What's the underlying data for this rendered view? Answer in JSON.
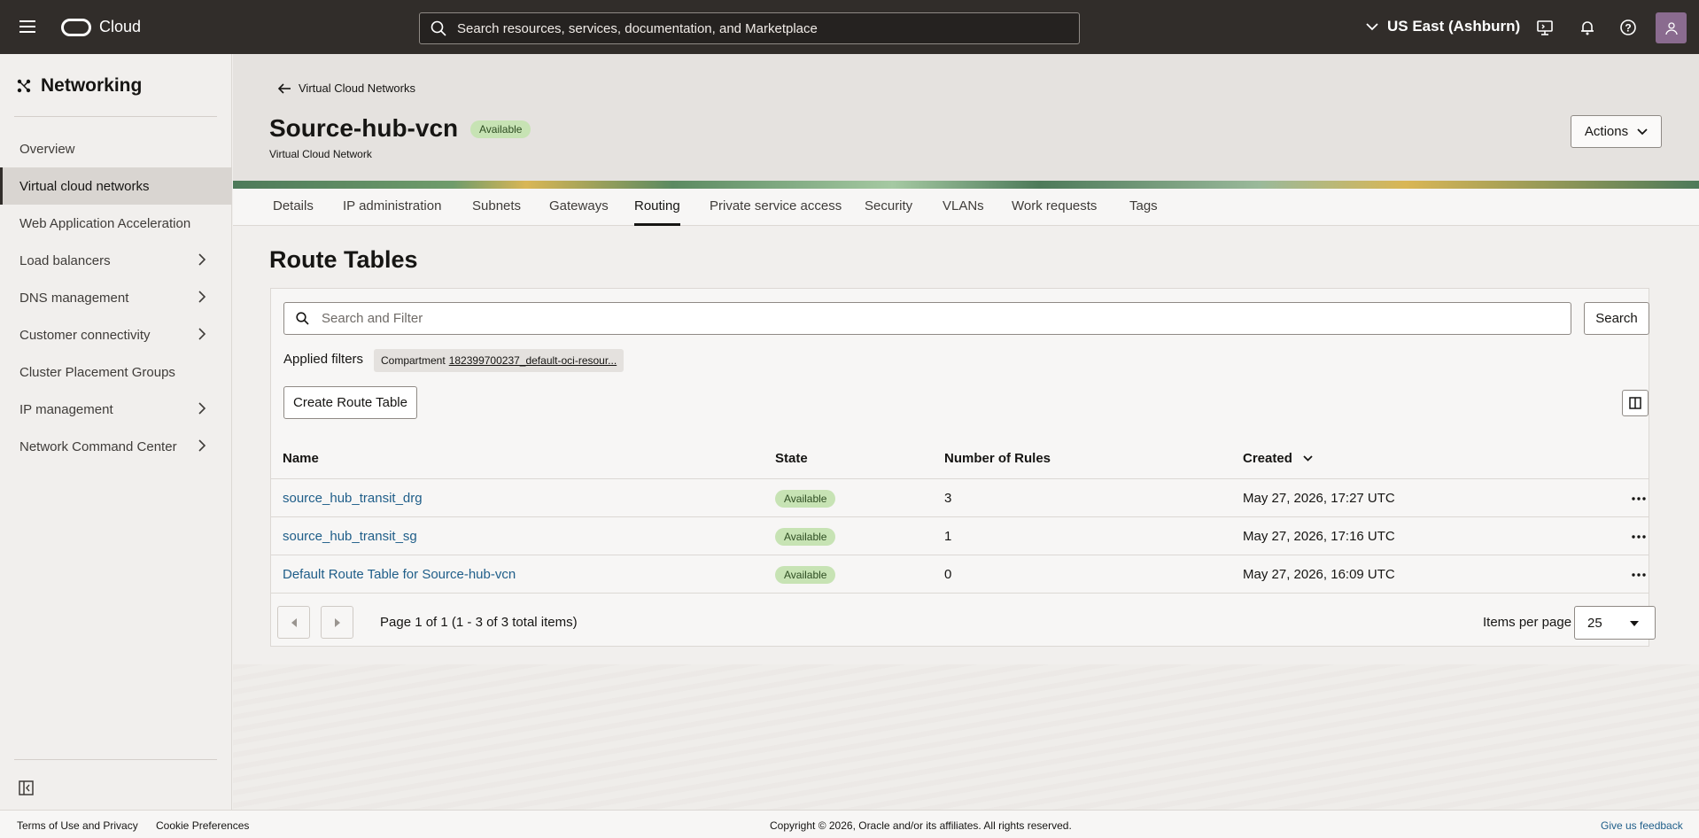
{
  "topbar": {
    "brand": "Cloud",
    "search_placeholder": "Search resources, services, documentation, and Marketplace",
    "region": "US East (Ashburn)"
  },
  "sidebar": {
    "title": "Networking",
    "items": [
      {
        "label": "Overview"
      },
      {
        "label": "Virtual cloud networks"
      },
      {
        "label": "Web Application Acceleration"
      },
      {
        "label": "Load balancers"
      },
      {
        "label": "DNS management"
      },
      {
        "label": "Customer connectivity"
      },
      {
        "label": "Cluster Placement Groups"
      },
      {
        "label": "IP management"
      },
      {
        "label": "Network Command Center"
      }
    ]
  },
  "header": {
    "back_label": "Virtual Cloud Networks",
    "title": "Source-hub-vcn",
    "status": "Available",
    "subtitle": "Virtual Cloud Network",
    "actions_label": "Actions"
  },
  "tabs": [
    "Details",
    "IP administration",
    "Subnets",
    "Gateways",
    "Routing",
    "Private service access",
    "Security",
    "VLANs",
    "Work requests",
    "Tags"
  ],
  "route_tables": {
    "title": "Route Tables",
    "filter_placeholder": "Search and Filter",
    "search_label": "Search",
    "applied_filters_label": "Applied filters",
    "chip_key": "Compartment",
    "chip_value": "182399700237_default-oci-resour...",
    "create_label": "Create Route Table",
    "columns": {
      "name": "Name",
      "state": "State",
      "rules": "Number of Rules",
      "created": "Created"
    },
    "rows": [
      {
        "name": "source_hub_transit_drg",
        "state": "Available",
        "rules": "3",
        "created": "May 27, 2026, 17:27 UTC"
      },
      {
        "name": "source_hub_transit_sg",
        "state": "Available",
        "rules": "1",
        "created": "May 27, 2026, 17:16 UTC"
      },
      {
        "name": "Default Route Table for Source-hub-vcn",
        "state": "Available",
        "rules": "0",
        "created": "May 27, 2026, 16:09 UTC"
      }
    ],
    "pagination": "Page 1 of 1 (1 - 3 of 3 total items)",
    "items_per_page_label": "Items per page",
    "items_per_page": "25"
  },
  "footer": {
    "terms": "Terms of Use and Privacy",
    "cookies": "Cookie Preferences",
    "copyright": "Copyright © 2026, Oracle and/or its affiliates. All rights reserved.",
    "feedback": "Give us feedback"
  },
  "colors": {
    "topbar": "#312d2a",
    "link": "#1f5e89",
    "badge_bg": "#c7e3b4"
  }
}
